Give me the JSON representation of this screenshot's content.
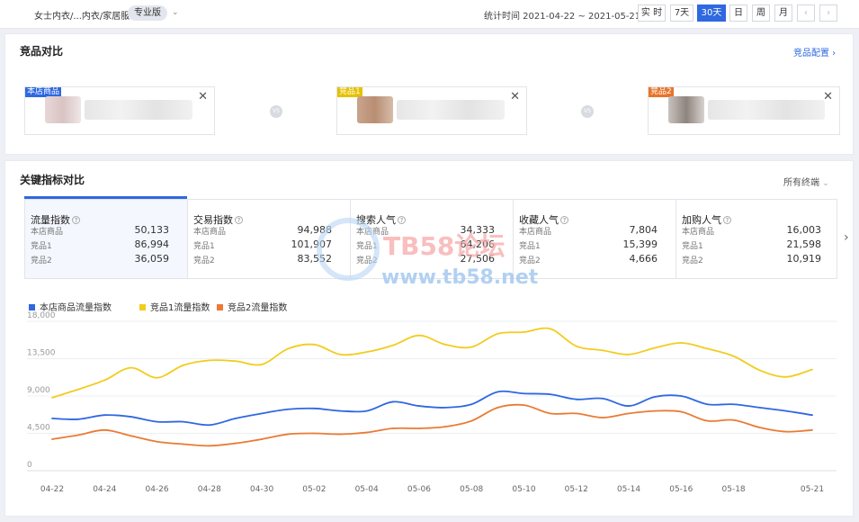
{
  "topbar": {
    "category": "女士内衣/...内衣/家居服",
    "edition": "专业版",
    "date_range": "统计时间 2021-04-22 ~ 2021-05-21",
    "buttons": [
      "实 时",
      "7天",
      "30天",
      "日",
      "周",
      "月"
    ],
    "active_button": "30天",
    "prev": "‹",
    "next": "›"
  },
  "compare": {
    "title": "竞品对比",
    "config_link": "竞品配置 ›",
    "vs": "VS",
    "items": [
      {
        "tag": "本店商品",
        "color": "#2f68e0"
      },
      {
        "tag": "竞品1",
        "color": "#e6c100"
      },
      {
        "tag": "竞品2",
        "color": "#e8742a"
      }
    ]
  },
  "metrics": {
    "title": "关键指标对比",
    "filter": "所有终端",
    "columns": [
      {
        "name": "流量指数",
        "rows": [
          {
            "label": "本店商品",
            "value": "50,133"
          },
          {
            "label": "竞品1",
            "value": "86,994"
          },
          {
            "label": "竞品2",
            "value": "36,059"
          }
        ]
      },
      {
        "name": "交易指数",
        "rows": [
          {
            "label": "本店商品",
            "value": "94,988"
          },
          {
            "label": "竞品1",
            "value": "101,907"
          },
          {
            "label": "竞品2",
            "value": "83,552"
          }
        ]
      },
      {
        "name": "搜索人气",
        "rows": [
          {
            "label": "本店商品",
            "value": "34,333"
          },
          {
            "label": "竞品1",
            "value": "64,206"
          },
          {
            "label": "竞品2",
            "value": "27,506"
          }
        ]
      },
      {
        "name": "收藏人气",
        "rows": [
          {
            "label": "本店商品",
            "value": "7,804"
          },
          {
            "label": "竞品1",
            "value": "15,399"
          },
          {
            "label": "竞品2",
            "value": "4,666"
          }
        ]
      },
      {
        "name": "加购人气",
        "rows": [
          {
            "label": "本店商品",
            "value": "16,003"
          },
          {
            "label": "竞品1",
            "value": "21,598"
          },
          {
            "label": "竞品2",
            "value": "10,919"
          }
        ]
      }
    ]
  },
  "watermark": {
    "line1": "TB58论坛",
    "line2": "www.tb58.net"
  },
  "chart_data": {
    "type": "line",
    "x": [
      "04-22",
      "04-23",
      "04-24",
      "04-25",
      "04-26",
      "04-27",
      "04-28",
      "04-29",
      "04-30",
      "05-01",
      "05-02",
      "05-03",
      "05-04",
      "05-05",
      "05-06",
      "05-07",
      "05-08",
      "05-09",
      "05-10",
      "05-11",
      "05-12",
      "05-13",
      "05-14",
      "05-15",
      "05-16",
      "05-17",
      "05-18",
      "05-19",
      "05-20",
      "05-21"
    ],
    "tick_labels": [
      "04-22",
      "04-24",
      "04-26",
      "04-28",
      "04-30",
      "05-02",
      "05-04",
      "05-06",
      "05-08",
      "05-10",
      "05-12",
      "05-14",
      "05-16",
      "05-18",
      "05-21"
    ],
    "yticks": [
      0,
      4500,
      9000,
      13500,
      18000
    ],
    "ytick_labels": [
      "0",
      "4,500",
      "9,000",
      "13,500",
      "18,000"
    ],
    "ylim": [
      0,
      18000
    ],
    "series": [
      {
        "name": "本店商品流量指数",
        "color": "#2f68e0",
        "values": [
          6300,
          6200,
          6700,
          6500,
          5900,
          5900,
          5500,
          6300,
          6900,
          7400,
          7500,
          7200,
          7200,
          8300,
          7800,
          7600,
          8000,
          9500,
          9300,
          9200,
          8600,
          8700,
          7800,
          8900,
          9000,
          8000,
          8000,
          7600,
          7200,
          6700
        ]
      },
      {
        "name": "竞品1流量指数",
        "color": "#f2cc1f",
        "values": [
          8800,
          9800,
          10900,
          12400,
          11200,
          12700,
          13300,
          13200,
          12800,
          14700,
          15200,
          14000,
          14300,
          15100,
          16300,
          15200,
          14900,
          16500,
          16700,
          17100,
          15000,
          14500,
          14000,
          14800,
          15400,
          14700,
          13800,
          12100,
          11300,
          12200
        ]
      },
      {
        "name": "竞品2流量指数",
        "color": "#ea7a35",
        "values": [
          3800,
          4300,
          4900,
          4200,
          3500,
          3200,
          3000,
          3300,
          3800,
          4400,
          4500,
          4400,
          4600,
          5100,
          5100,
          5300,
          6000,
          7600,
          7900,
          6900,
          6900,
          6400,
          6900,
          7200,
          7100,
          6000,
          6100,
          5200,
          4700,
          4900
        ]
      }
    ]
  }
}
